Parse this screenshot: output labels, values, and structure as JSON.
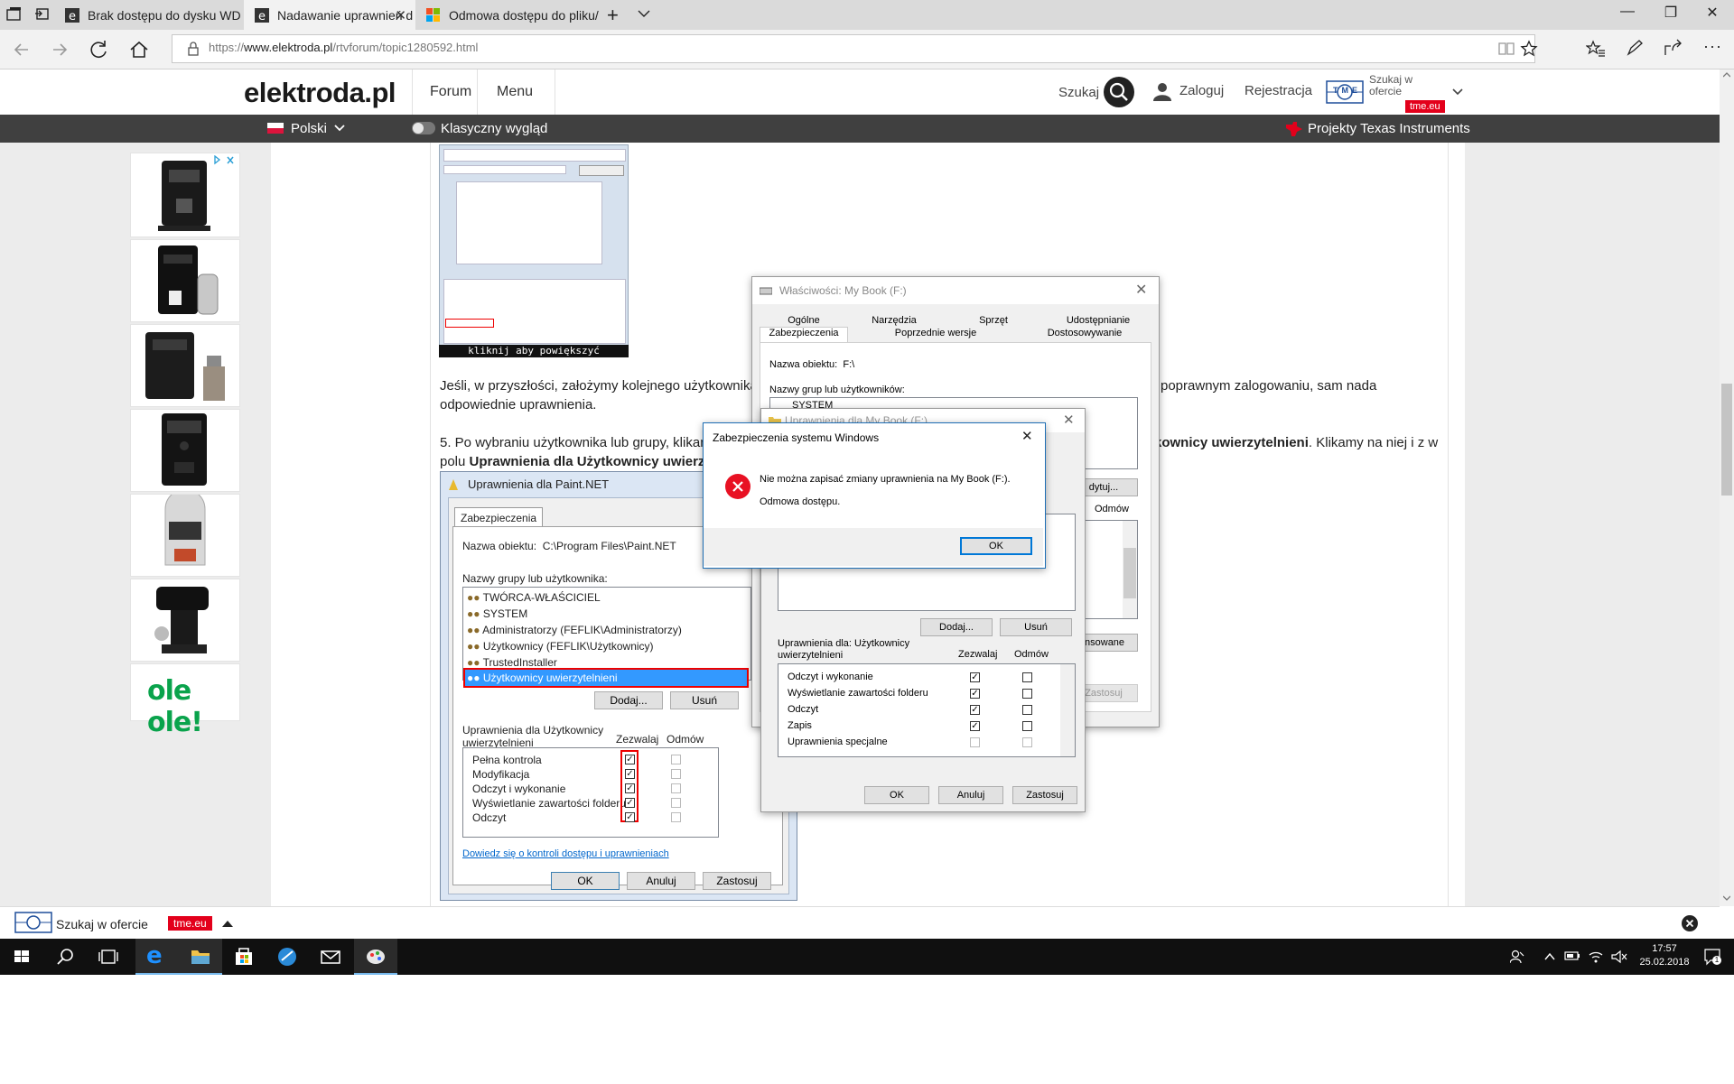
{
  "browser": {
    "tabs": [
      {
        "title": "Brak dostępu do dysku WD"
      },
      {
        "title": "Nadawanie uprawnień d"
      },
      {
        "title": "Odmowa dostępu do pliku/"
      }
    ],
    "url_prefix": "https://",
    "url_domain": "www.elektroda.pl",
    "url_path": "/rtvforum/topic1280592.html"
  },
  "site": {
    "logo": "elektroda.pl",
    "nav": [
      "Forum",
      "Menu"
    ],
    "search_label": "Szukaj",
    "login_label": "Zaloguj",
    "register_label": "Rejestracja",
    "tme_search": "Szukaj w ofercie",
    "tme_badge": "tme.eu",
    "tme_logo": "TME",
    "language": "Polski",
    "classic_view": "Klasyczny wygląd",
    "ti_projects": "Projekty Texas Instruments"
  },
  "ads": {
    "oleole": "ole ole!"
  },
  "article": {
    "thumb_caption": "kliknij aby powiększyć",
    "para1_a": "Jeśli, w przyszłości, założymy kolejnego użytkownika,",
    "para1_b": "poprawnym zalogowaniu, sam nada",
    "para1_c": "odpowiednie uprawnienia.",
    "para2_a": "5. Po wybraniu użytkownika lub grupy, klikam",
    "para2_b_bold": "kownicy uwierzytelnieni",
    "para2_c": ". Klikamy na niej i z w",
    "para2_d": "polu",
    "para2_e_bold": "Uprawnienia dla Użytkownicy uwierzyte"
  },
  "paint_dialog": {
    "title": "Uprawnienia dla Paint.NET",
    "tab": "Zabezpieczenia",
    "object_label": "Nazwa obiektu:",
    "object_value": "C:\\Program Files\\Paint.NET",
    "groups_label": "Nazwy grupy lub użytkownika:",
    "groups": [
      "TWÓRCA-WŁAŚCICIEL",
      "SYSTEM",
      "Administratorzy (FEFLIK\\Administratorzy)",
      "Użytkownicy (FEFLIK\\Użytkownicy)",
      "TrustedInstaller",
      "Użytkownicy uwierzytelnieni"
    ],
    "add": "Dodaj...",
    "remove": "Usuń",
    "perm_label_1": "Uprawnienia dla Użytkownicy",
    "perm_label_2": "uwierzytelnieni",
    "allow": "Zezwalaj",
    "deny": "Odmów",
    "perms": [
      "Pełna kontrola",
      "Modyfikacja",
      "Odczyt i wykonanie",
      "Wyświetlanie zawartości folderu",
      "Odczyt"
    ],
    "link": "Dowiedz się o kontroli dostępu i uprawnieniach",
    "ok": "OK",
    "cancel": "Anuluj",
    "apply": "Zastosuj"
  },
  "props_dialog": {
    "title": "Właściwości: My Book (F:)",
    "tabs_row1": [
      "Ogólne",
      "Narzędzia",
      "Sprzęt",
      "Udostępnianie"
    ],
    "tabs_row2": [
      "Zabezpieczenia",
      "Poprzednie wersje",
      "Dostosowywanie"
    ],
    "object_label": "Nazwa obiektu:",
    "object_value": "F:\\",
    "groups_label": "Nazwy grup lub użytkowników:",
    "first_group": "SYSTEM",
    "edit": "dytuj...",
    "deny": "Odmów",
    "advanced": "wansowane",
    "apply": "Zastosuj"
  },
  "perm_dialog": {
    "title": "Uprawnienia dla My Book (F:)",
    "add": "Dodaj...",
    "remove": "Usuń",
    "perm_label_1": "Uprawnienia dla: Użytkownicy",
    "perm_label_2": "uwierzytelnieni",
    "allow": "Zezwalaj",
    "deny": "Odmów",
    "perms": [
      "Odczyt i wykonanie",
      "Wyświetlanie zawartości folderu",
      "Odczyt",
      "Zapis",
      "Uprawnienia specjalne"
    ],
    "ok": "OK",
    "cancel": "Anuluj",
    "apply": "Zastosuj"
  },
  "error_dialog": {
    "title": "Zabezpieczenia systemu Windows",
    "message": "Nie można zapisać zmiany uprawnienia na My Book (F:).",
    "detail": "Odmowa dostępu.",
    "ok": "OK"
  },
  "tme_bar": {
    "text": "Szukaj w ofercie",
    "badge": "tme.eu"
  },
  "taskbar": {
    "time": "17:57",
    "date": "25.02.2018",
    "notifications": "1"
  },
  "colors": {
    "accent_red": "#e3001b",
    "site_dark": "#404040",
    "taskbar": "#101010",
    "link_blue": "#0066cc"
  }
}
